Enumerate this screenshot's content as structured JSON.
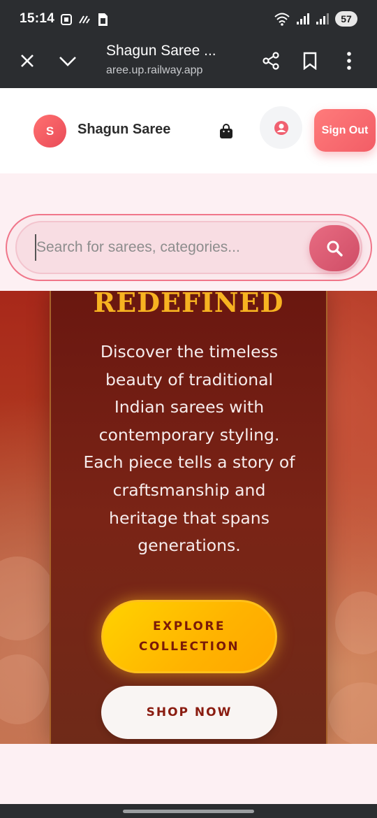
{
  "status_bar": {
    "time": "15:14",
    "battery": "57",
    "icons_left": [
      "screenshot-icon",
      "nfc-icon",
      "sim-icon"
    ],
    "icons_right": [
      "wifi-icon",
      "signal-icon",
      "signal-icon"
    ]
  },
  "browser": {
    "title": "Shagun Saree ...",
    "url": "aree.up.railway.app",
    "icons": [
      "close-icon",
      "chevron-down-icon",
      "share-icon",
      "bookmark-icon",
      "more-vert-icon"
    ]
  },
  "header": {
    "logo_letter": "S",
    "brand": "Shagun Saree",
    "sign_out_label": "Sign Out",
    "accent_color": "#f25d66"
  },
  "search": {
    "placeholder": "Search for sarees, categories..."
  },
  "hero": {
    "headline": "REDEFINED",
    "description": "Discover the timeless beauty of traditional Indian sarees with contemporary styling. Each piece tells a story of craftsmanship and heritage that spans generations.",
    "explore_label": "EXPLORE COLLECTION",
    "shop_label": "SHOP NOW",
    "headline_color": "#f7b321"
  }
}
